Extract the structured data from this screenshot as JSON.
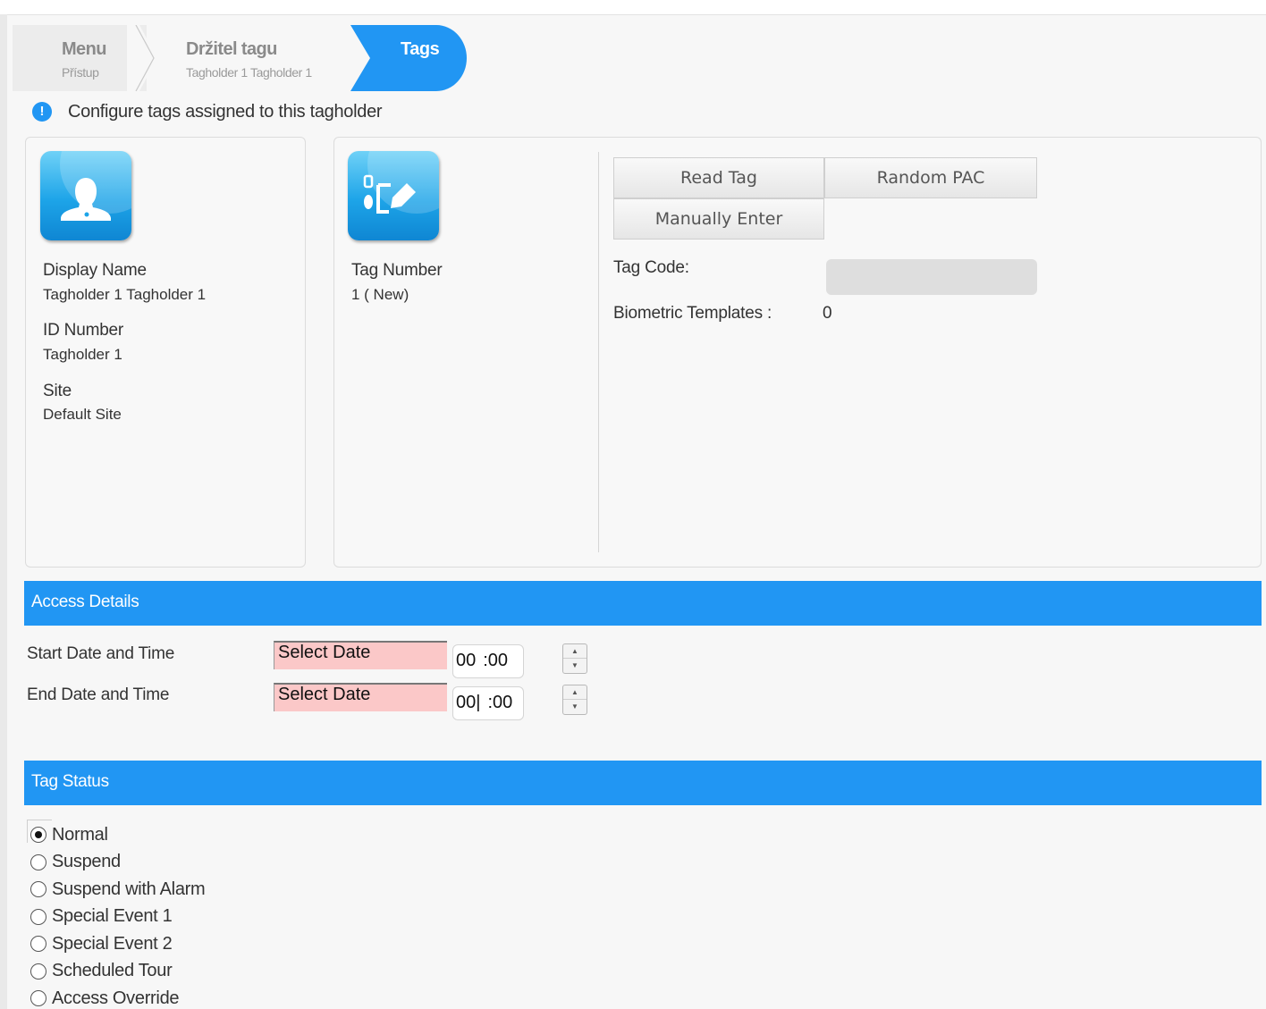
{
  "breadcrumb": {
    "menu": {
      "title": "Menu",
      "subtitle": "Přístup"
    },
    "holder": {
      "title": "Držitel tagu",
      "subtitle": "Tagholder 1 Tagholder 1"
    },
    "tags": {
      "title": "Tags"
    }
  },
  "info": {
    "icon": "info-icon",
    "text": "Configure tags assigned to this tagholder"
  },
  "tagholder": {
    "icon": "person-icon",
    "display_name_label": "Display Name",
    "display_name": "Tagholder 1 Tagholder 1",
    "id_label": "ID Number",
    "id_value": "Tagholder 1",
    "site_label": "Site",
    "site_value": "Default Site"
  },
  "tag": {
    "icon": "tag-edit-icon",
    "number_label": "Tag Number",
    "number_value": "1 ( New)",
    "buttons": {
      "read": "Read Tag",
      "random": "Random PAC",
      "manual": "Manually Enter"
    },
    "code_label": "Tag Code:",
    "code_value": "",
    "biometric_label": "Biometric Templates :",
    "biometric_value": "0"
  },
  "access": {
    "title": "Access Details",
    "start_label": "Start Date and Time",
    "end_label": "End Date and Time",
    "start_date": "Select Date",
    "end_date": "Select Date",
    "start_hh": "00",
    "start_mm": ":00",
    "end_hh": "00|",
    "end_mm": ":00"
  },
  "status": {
    "title": "Tag Status",
    "selected": "Normal",
    "options": [
      "Normal",
      "Suspend",
      "Suspend with Alarm",
      "Special Event 1",
      "Special Event 2",
      "Scheduled Tour",
      "Access Override"
    ]
  },
  "colors": {
    "accent": "#2196f3",
    "date_invalid": "#fbc8c8"
  }
}
